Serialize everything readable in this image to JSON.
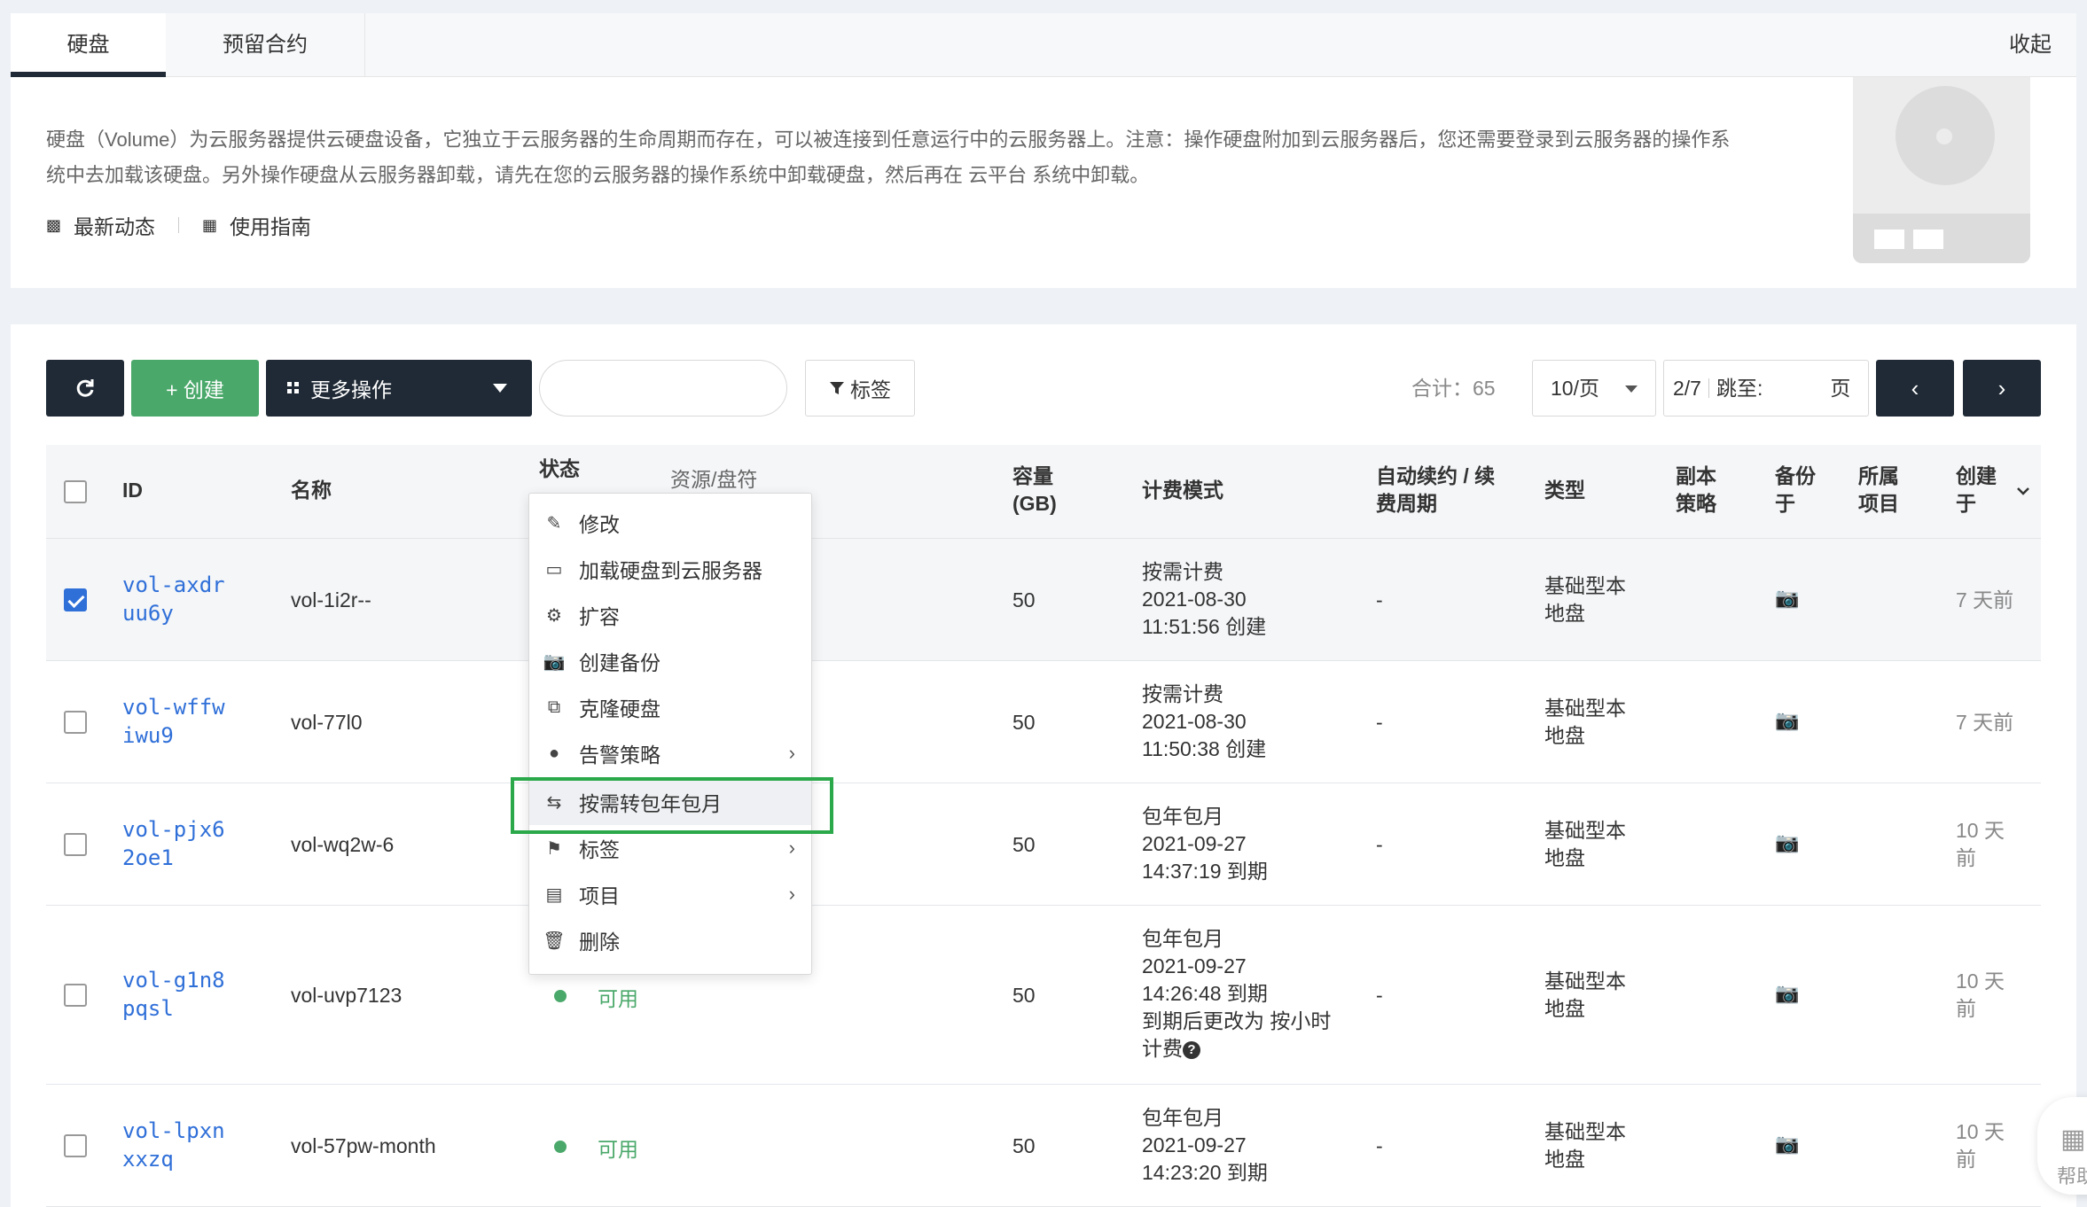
{
  "tabs": [
    {
      "label": "硬盘",
      "active": true
    },
    {
      "label": "预留合约",
      "active": false
    }
  ],
  "collapse_label": "收起",
  "description": "硬盘（Volume）为云服务器提供云硬盘设备，它独立于云服务器的生命周期而存在，可以被连接到任意运行中的云服务器上。注意：操作硬盘附加到云服务器后，您还需要登录到云服务器的操作系统中去加载该硬盘。另外操作硬盘从云服务器卸载，请先在您的云服务器的操作系统中卸载硬盘，然后再在 云平台 系统中卸载。",
  "links": {
    "news": "最新动态",
    "guide": "使用指南"
  },
  "toolbar": {
    "refresh_icon": "refresh-icon",
    "create_label": "+ 创建",
    "more_label": "更多操作",
    "search_placeholder": "",
    "tag_label": "标签",
    "total_label": "合计：65",
    "per_page": "10/页",
    "page_current": "2/7",
    "jump_label": "跳至:",
    "page_suffix": "页",
    "prev_icon": "‹",
    "next_icon": "›"
  },
  "columns": {
    "id": "ID",
    "name": "名称",
    "status": "状态",
    "resource": "资源/盘符",
    "capacity": "容量\n(GB)",
    "billing": "计费模式",
    "renew": "自动续约 / 续\n费周期",
    "type": "类型",
    "replica": "副本\n策略",
    "backup": "备份\n于",
    "project": "所属\n项目",
    "created": "创建\n于"
  },
  "rows": [
    {
      "id": "vol-axdr\nuu6y",
      "name": "vol-1i2r--",
      "status": "",
      "capacity": "50",
      "billing": "按需计费\n2021-08-30\n11:51:56 创建",
      "renew": "-",
      "type": "基础型本\n地盘",
      "created": "7 天前",
      "selected": true
    },
    {
      "id": "vol-wffw\niwu9",
      "name": "vol-77l0",
      "status": "",
      "capacity": "50",
      "billing": "按需计费\n2021-08-30\n11:50:38 创建",
      "renew": "-",
      "type": "基础型本\n地盘",
      "created": "7 天前",
      "selected": false
    },
    {
      "id": "vol-pjx6\n2oe1",
      "name": "vol-wq2w-6",
      "status": "",
      "capacity": "50",
      "billing": "包年包月\n2021-09-27\n14:37:19 到期",
      "renew": "-",
      "type": "基础型本\n地盘",
      "created": "10 天\n前",
      "selected": false
    },
    {
      "id": "vol-g1n8\npqsl",
      "name": "vol-uvp7123",
      "status": "可用",
      "capacity": "50",
      "billing": "包年包月\n2021-09-27\n14:26:48 到期\n到期后更改为 按小时\n计费",
      "renew": "-",
      "type": "基础型本\n地盘",
      "created": "10 天\n前",
      "selected": false
    },
    {
      "id": "vol-lpxn\nxxzq",
      "name": "vol-57pw-month",
      "status": "可用",
      "capacity": "50",
      "billing": "包年包月\n2021-09-27\n14:23:20 到期",
      "renew": "-",
      "type": "基础型本\n地盘",
      "created": "10 天\n前",
      "selected": false
    }
  ],
  "menu": [
    {
      "label": "修改",
      "icon": "pencil-icon"
    },
    {
      "label": "加载硬盘到云服务器",
      "icon": "monitor-icon"
    },
    {
      "label": "扩容",
      "icon": "gear-icon"
    },
    {
      "label": "创建备份",
      "icon": "camera-icon"
    },
    {
      "label": "克隆硬盘",
      "icon": "clone-icon"
    },
    {
      "label": "告警策略",
      "icon": "bell-icon",
      "submenu": true
    },
    {
      "label": "按需转包年包月",
      "icon": "exchange-icon",
      "highlighted": true
    },
    {
      "label": "标签",
      "icon": "tags-icon",
      "submenu": true
    },
    {
      "label": "项目",
      "icon": "archive-icon",
      "submenu": true
    },
    {
      "label": "删除",
      "icon": "trash-icon"
    }
  ],
  "help_label": "帮助",
  "colors": {
    "primary_dark": "#1f2a36",
    "create_green": "#4aa86a",
    "link_blue": "#2f6fd8",
    "highlight_green": "#2aa84a"
  }
}
